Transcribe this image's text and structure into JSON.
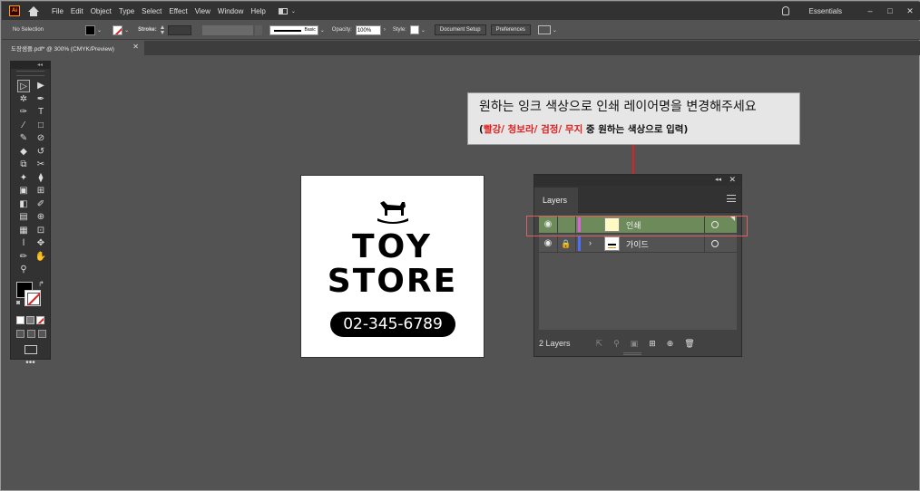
{
  "app": {
    "logo": "Ai",
    "menu": [
      "File",
      "Edit",
      "Object",
      "Type",
      "Select",
      "Effect",
      "View",
      "Window",
      "Help"
    ],
    "workspace": "Essentials",
    "window_buttons": [
      "–",
      "□",
      "✕"
    ]
  },
  "control_bar": {
    "selection": "No Selection",
    "stroke_label": "Stroke:",
    "brush": "Basic",
    "opacity_label": "Opacity:",
    "opacity_value": "100%",
    "style_label": "Style:",
    "document_setup": "Document Setup",
    "preferences": "Preferences"
  },
  "document_tab": {
    "title": "도장샘플.pdf* @ 300% (CMYK/Preview)",
    "close": "✕"
  },
  "tools": {
    "collapse": "◂◂",
    "items": [
      "▷",
      "▶",
      "✲",
      "✒",
      "✑",
      "T",
      "⁄",
      "□",
      "✎",
      "⊘",
      "◆",
      "↺",
      "⧉",
      "✂",
      "✦",
      "⧫",
      "▣",
      "⊞",
      "◧",
      "✐",
      "▤",
      "⊕",
      "▦",
      "⊡",
      "ⅼ",
      "✥",
      "✏",
      "✋",
      "⚲"
    ],
    "more": "•••"
  },
  "artboard": {
    "line1": "TOY",
    "line2": "STORE",
    "phone": "02-345-6789"
  },
  "callout": {
    "line1": "원하는 잉크 색상으로 인쇄 레이어명을 변경해주세요",
    "line2_open": "(",
    "line2_red": "빨강/ 청보라/ 검정/ 무지",
    "line2_rest": " 중 원하는 색상으로 입력)"
  },
  "layers_panel": {
    "collapse": "◂◂",
    "close": "✕",
    "tab": "Layers",
    "layers": [
      {
        "name": "인쇄",
        "color": "#e060e0",
        "selected": true
      },
      {
        "name": "가이드",
        "color": "#4f6ef7",
        "selected": false
      }
    ],
    "count": "2 Layers"
  },
  "colors": {
    "selected_layer": "#6d8a5a",
    "annotation_red": "#e02020"
  }
}
